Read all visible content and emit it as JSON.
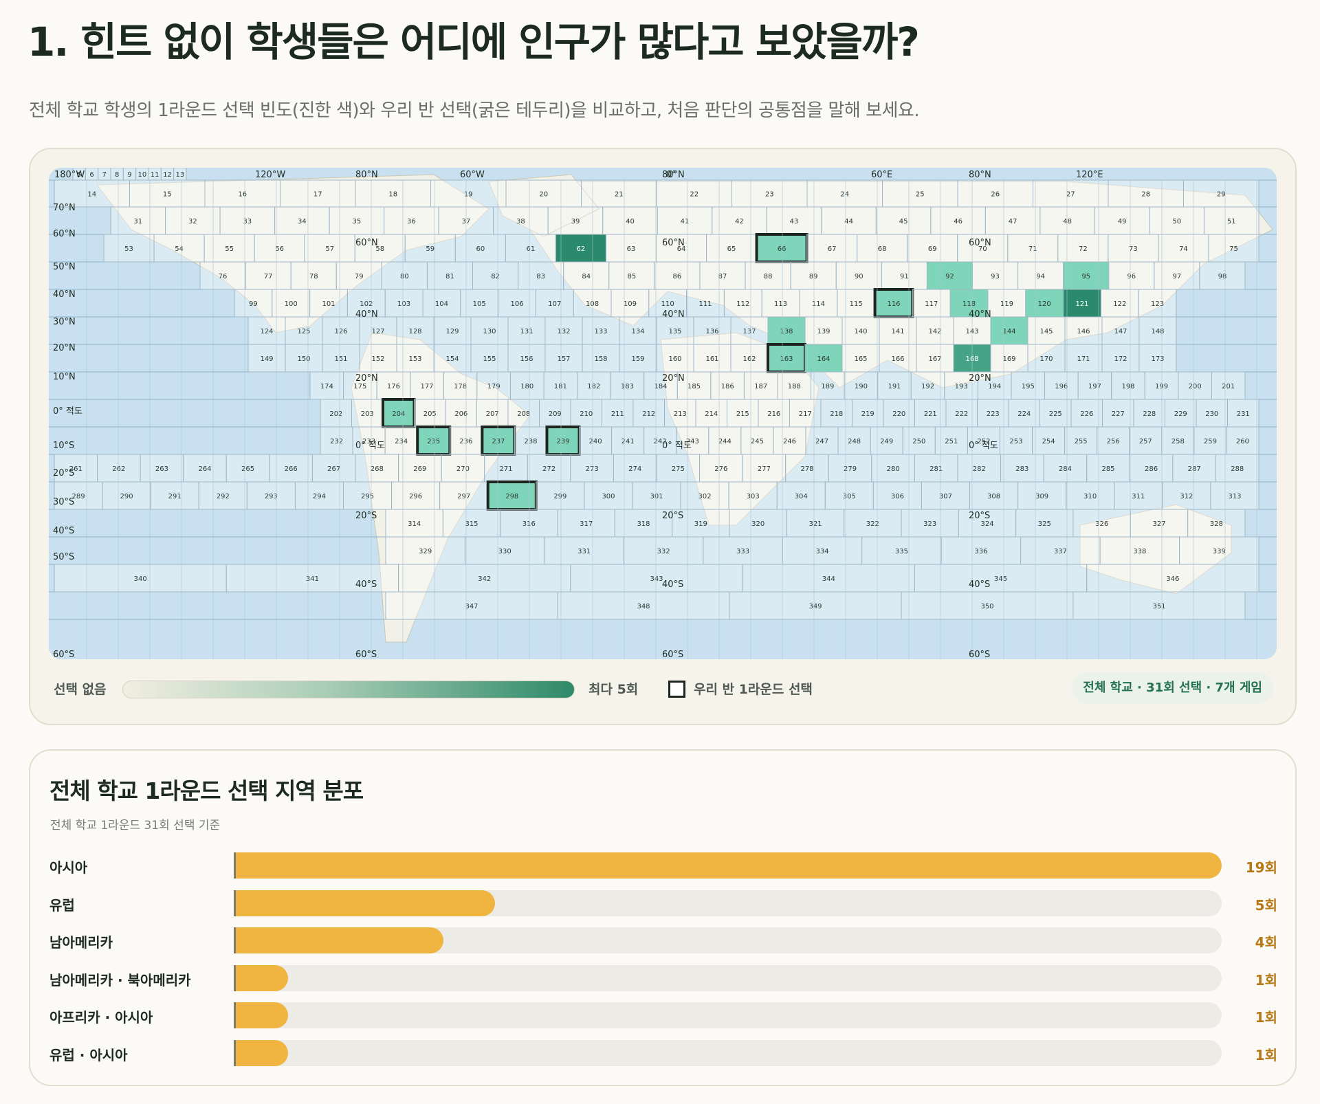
{
  "page": {
    "title": "1. 힌트 없이 학생들은 어디에 인구가 많다고 보았을까?",
    "subtitle": "전체 학교 학생의 1라운드 선택 빈도(진한 색)와 우리 반 선택(굵은 테두리)을 비교하고, 처음 판단의 공통점을 말해 보세요."
  },
  "map": {
    "lon_labels": [
      "180°W",
      "120°W",
      "60°W",
      "0°",
      "60°E",
      "120°E"
    ],
    "lat_labels": [
      "70°N",
      "60°N",
      "50°N",
      "40°N",
      "30°N",
      "20°N",
      "10°N",
      "0° 적도",
      "10°S",
      "20°S",
      "30°S",
      "40°S",
      "50°S",
      "60°S"
    ],
    "inner_labels": [
      {
        "text": "80°N"
      },
      {
        "text": "60°N"
      },
      {
        "text": "40°N"
      },
      {
        "text": "20°N"
      },
      {
        "text": "0° 적도"
      },
      {
        "text": "20°S"
      },
      {
        "text": "40°S"
      },
      {
        "text": "60°S"
      }
    ],
    "selection_counts": {
      "62": 5,
      "66": 2,
      "92": 2,
      "95": 2,
      "116": 2,
      "118": 2,
      "120": 2,
      "121": 5,
      "138": 2,
      "144": 2,
      "163": 2,
      "164": 2,
      "168": 4,
      "204": 2,
      "235": 2,
      "237": 2,
      "239": 2,
      "298": 2
    },
    "class_selected": [
      66,
      116,
      163,
      204,
      235,
      237,
      239,
      298
    ],
    "colors": {
      "ocean": "#c8e0ef",
      "land": "#f2f1e8",
      "grid_ocean": "#8eb1c9",
      "low": "#7fd5b9",
      "high": "#2a8a6b"
    }
  },
  "legend": {
    "none_label": "선택 없음",
    "max_label": "최다 5회",
    "class_label": "우리 반 1라운드 선택",
    "total_badge": "전체 학교 · 31회 선택 · 7개 게임"
  },
  "distribution": {
    "title": "전체 학교 1라운드 선택 지역 분포",
    "subtitle": "전체 학교 1라운드 31회 선택 기준",
    "max": 19,
    "rows": [
      {
        "label": "아시아",
        "value": 19,
        "count_label": "19회"
      },
      {
        "label": "유럽",
        "value": 5,
        "count_label": "5회"
      },
      {
        "label": "남아메리카",
        "value": 4,
        "count_label": "4회"
      },
      {
        "label": "남아메리카 · 북아메리카",
        "value": 1,
        "count_label": "1회"
      },
      {
        "label": "아프리카 · 아시아",
        "value": 1,
        "count_label": "1회"
      },
      {
        "label": "유럽 · 아시아",
        "value": 1,
        "count_label": "1회"
      }
    ]
  }
}
